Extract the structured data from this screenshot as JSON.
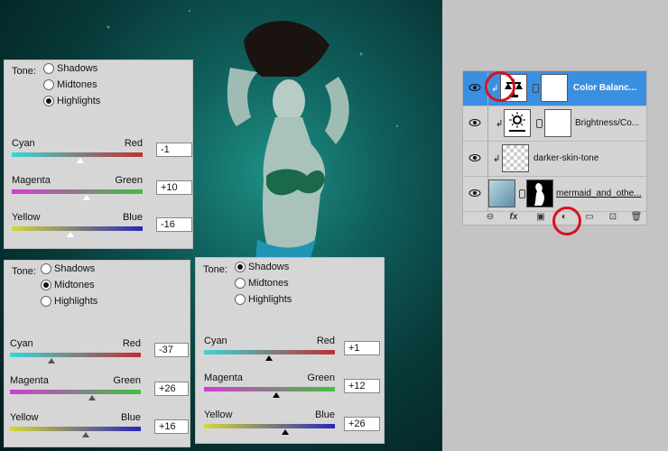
{
  "tone_label": "Tone:",
  "radio_options": [
    "Shadows",
    "Midtones",
    "Highlights"
  ],
  "panels": [
    {
      "id": "highlights",
      "selected": "Highlights",
      "sliders": [
        {
          "left": "Cyan",
          "right": "Red",
          "value": "-1"
        },
        {
          "left": "Magenta",
          "right": "Green",
          "value": "+10"
        },
        {
          "left": "Yellow",
          "right": "Blue",
          "value": "-16"
        }
      ]
    },
    {
      "id": "midtones",
      "selected": "Midtones",
      "sliders": [
        {
          "left": "Cyan",
          "right": "Red",
          "value": "-37"
        },
        {
          "left": "Magenta",
          "right": "Green",
          "value": "+26"
        },
        {
          "left": "Yellow",
          "right": "Blue",
          "value": "+16"
        }
      ]
    },
    {
      "id": "shadows",
      "selected": "Shadows",
      "sliders": [
        {
          "left": "Cyan",
          "right": "Red",
          "value": "+1"
        },
        {
          "left": "Magenta",
          "right": "Green",
          "value": "+12"
        },
        {
          "left": "Yellow",
          "right": "Blue",
          "value": "+26"
        }
      ]
    }
  ],
  "layers": [
    {
      "name": "Color Balanc...",
      "selected": true,
      "icon": "balance-scale-icon"
    },
    {
      "name": "Brightness/Co...",
      "selected": false,
      "icon": "brightness-icon"
    },
    {
      "name": "darker-skin-tone",
      "selected": false,
      "icon": "transparent-thumbnail"
    },
    {
      "name": "mermaid_and_othe...",
      "selected": false,
      "icon": "mermaid-thumbnail"
    }
  ],
  "layer_toolbar": [
    "link-icon",
    "fx-icon",
    "mask-icon",
    "adjustment-layer-icon",
    "folder-icon",
    "new-layer-icon",
    "trash-icon"
  ],
  "layer_toolbar_labels": {
    "fx": "fx"
  },
  "colors": {
    "accent_red": "#d9121e",
    "selection_blue": "#3b8fe0"
  }
}
